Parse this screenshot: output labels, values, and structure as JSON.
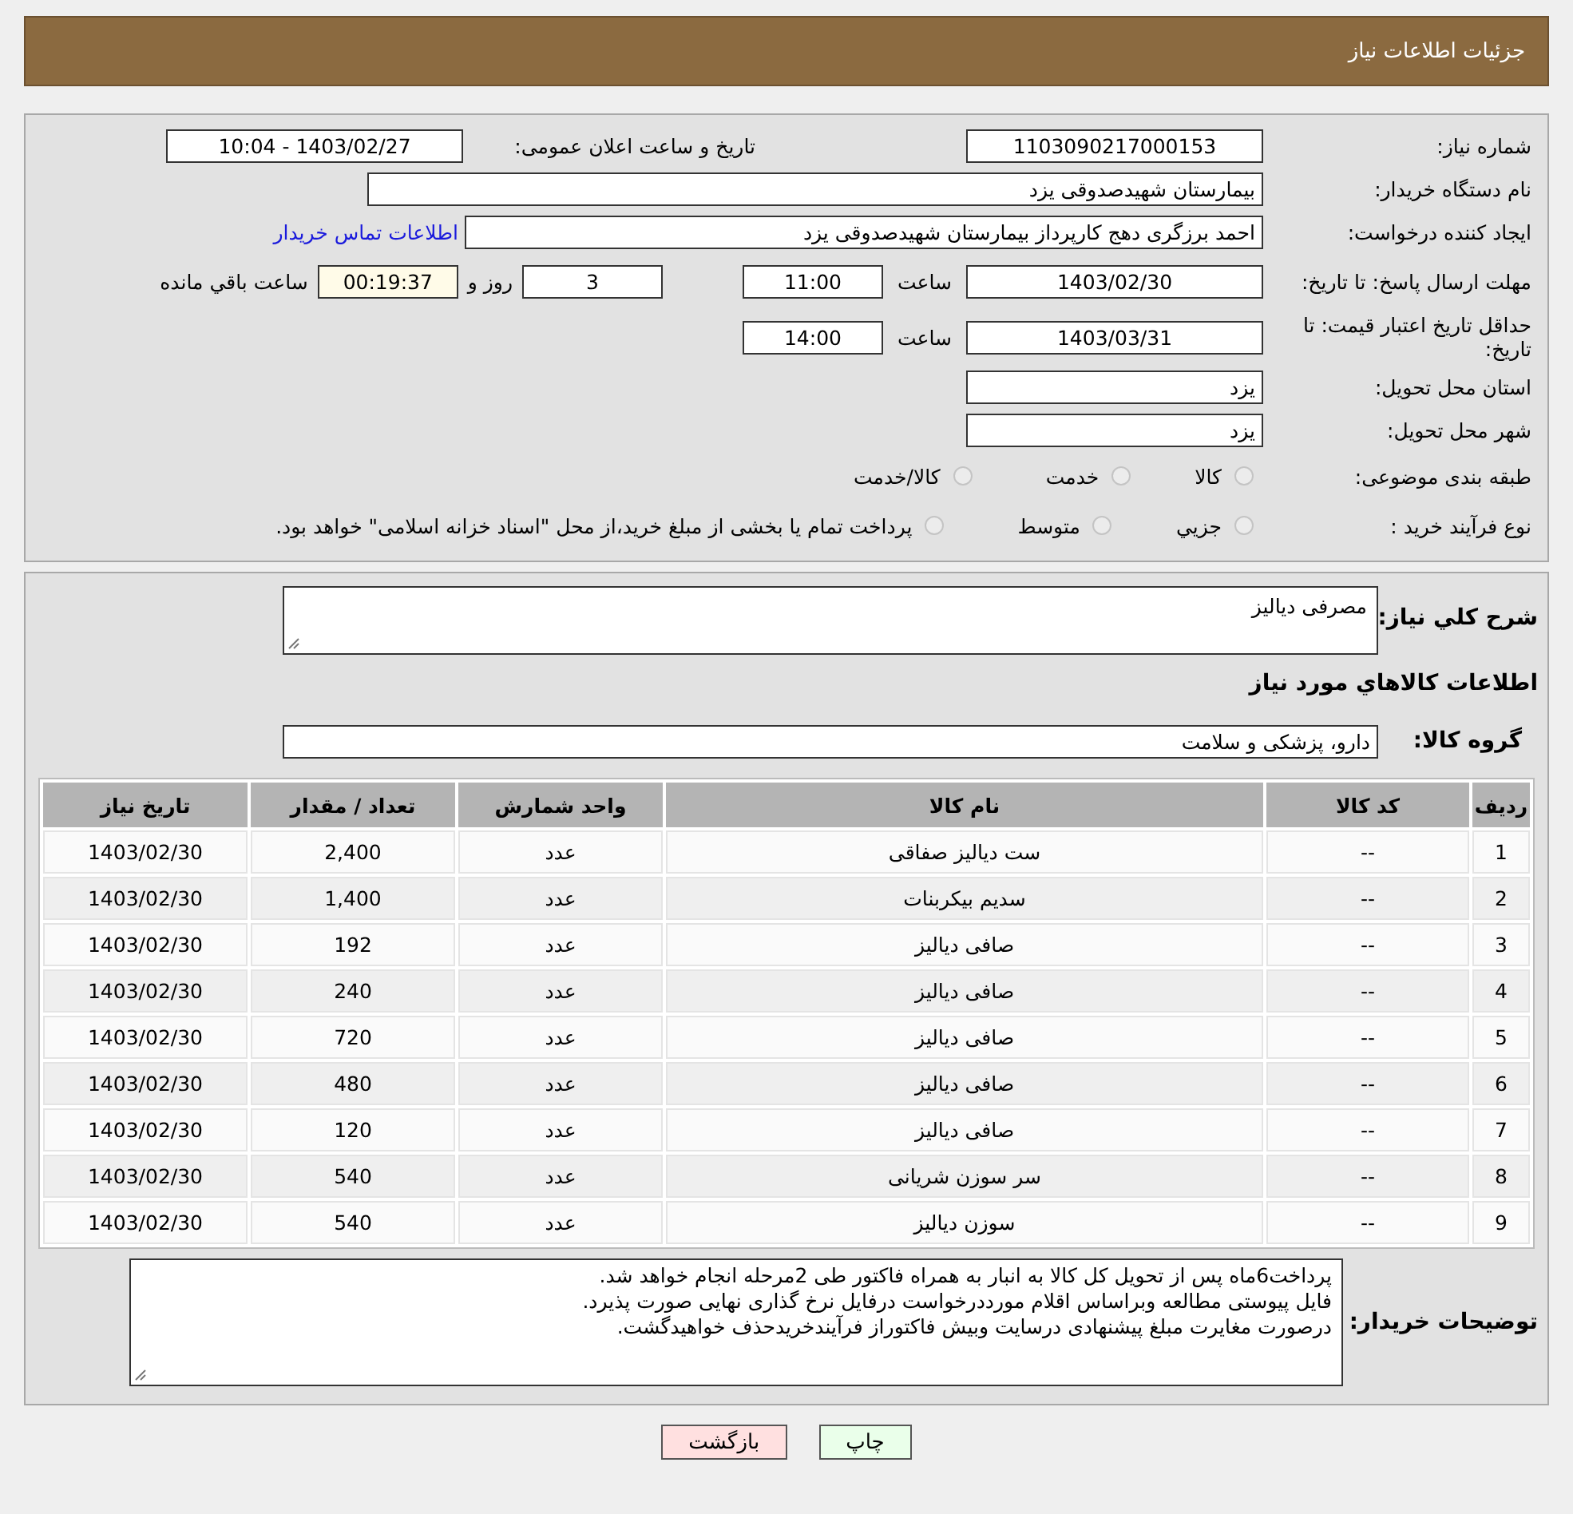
{
  "header": {
    "title": "جزئیات اطلاعات نیاز"
  },
  "details": {
    "need_number": {
      "label": "شماره نیاز:",
      "value": "1103090217000153"
    },
    "announce": {
      "label": "تاریخ و ساعت اعلان عمومی:",
      "value": "1403/02/27 - 10:04"
    },
    "buyer_org": {
      "label": "نام دستگاه خریدار:",
      "value": "بیمارستان شهیدصدوقی یزد"
    },
    "requester": {
      "label": "ایجاد کننده درخواست:",
      "value": "احمد برزگری دهج کارپرداز بیمارستان شهیدصدوقی یزد",
      "link": "اطلاعات تماس خریدار"
    },
    "reply_deadline": {
      "label": "مهلت ارسال پاسخ: تا تاریخ:",
      "date": "1403/02/30",
      "time_label": "ساعت",
      "time": "11:00",
      "days": "3",
      "days_label": "روز و",
      "remaining": "00:19:37",
      "remaining_label": "ساعت باقي مانده"
    },
    "price_validity": {
      "label": "حداقل تاریخ اعتبار قیمت: تا تاریخ:",
      "date": "1403/03/31",
      "time_label": "ساعت",
      "time": "14:00"
    },
    "province": {
      "label": "استان محل تحویل:",
      "value": "یزد"
    },
    "city": {
      "label": "شهر محل تحویل:",
      "value": "یزد"
    },
    "category": {
      "label": "طبقه بندی موضوعی:",
      "options": [
        {
          "label": "کالا",
          "selected": false
        },
        {
          "label": "خدمت",
          "selected": false
        },
        {
          "label": "کالا/خدمت",
          "selected": false
        }
      ]
    },
    "process": {
      "label": "نوع فرآیند خرید :",
      "options": [
        {
          "label": "جزيي",
          "selected": false
        },
        {
          "label": "متوسط",
          "selected": false
        },
        {
          "label": "پرداخت تمام یا بخشی از مبلغ خرید،از محل \"اسناد خزانه اسلامی\" خواهد بود.",
          "selected": false
        }
      ]
    }
  },
  "summary": {
    "label": "شرح کلي نياز:",
    "value": "مصرفی دیالیز"
  },
  "goods": {
    "title": "اطلاعات کالاهاي مورد نياز",
    "group_label": "گروه کالا:",
    "group_value": "دارو، پزشکی و سلامت",
    "table": {
      "columns": [
        "ردیف",
        "کد کالا",
        "نام کالا",
        "واحد شمارش",
        "تعداد / مقدار",
        "تاریخ نیاز"
      ],
      "rows": [
        [
          "1",
          "--",
          "ست دیالیز صفاقی",
          "عدد",
          "2,400",
          "1403/02/30"
        ],
        [
          "2",
          "--",
          "سدیم بیکربنات",
          "عدد",
          "1,400",
          "1403/02/30"
        ],
        [
          "3",
          "--",
          "صافی دیالیز",
          "عدد",
          "192",
          "1403/02/30"
        ],
        [
          "4",
          "--",
          "صافی دیالیز",
          "عدد",
          "240",
          "1403/02/30"
        ],
        [
          "5",
          "--",
          "صافی دیالیز",
          "عدد",
          "720",
          "1403/02/30"
        ],
        [
          "6",
          "--",
          "صافی دیالیز",
          "عدد",
          "480",
          "1403/02/30"
        ],
        [
          "7",
          "--",
          "صافی دیالیز",
          "عدد",
          "120",
          "1403/02/30"
        ],
        [
          "8",
          "--",
          "سر سوزن شریانی",
          "عدد",
          "540",
          "1403/02/30"
        ],
        [
          "9",
          "--",
          "سوزن دیالیز",
          "عدد",
          "540",
          "1403/02/30"
        ]
      ]
    }
  },
  "notes": {
    "label": "توضیحات خریدار:",
    "lines": [
      "پرداخت6ماه پس از تحویل کل کالا به انبار به همراه فاکتور طی 2مرحله انجام خواهد شد.",
      "فایل پیوستی مطالعه وبراساس اقلام مورددرخواست درفایل نرخ گذاری نهایی  صورت پذیرد.",
      "درصورت مغایرت مبلغ پیشنهادی درسایت وبیش فاکتوراز فرآیندخریدحذف خواهیدگشت."
    ]
  },
  "buttons": [
    {
      "kind": "print",
      "label": "چاپ"
    },
    {
      "kind": "back",
      "label": "بازگشت"
    }
  ]
}
